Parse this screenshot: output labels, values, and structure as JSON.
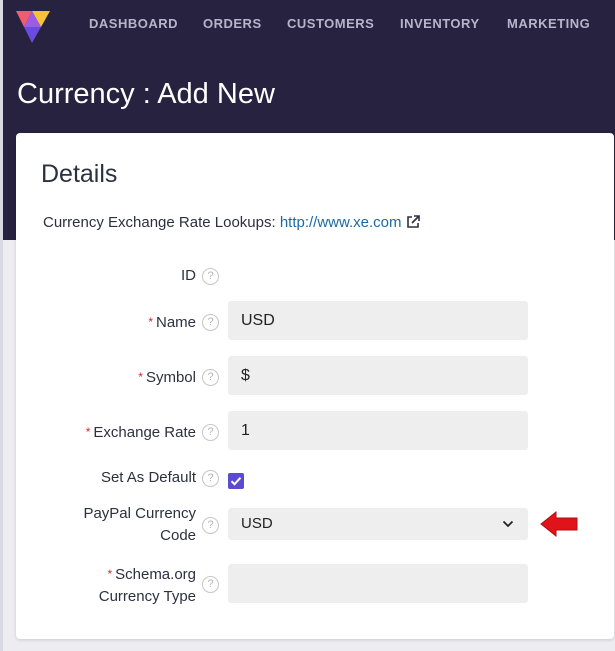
{
  "nav": {
    "items": [
      {
        "label": "DASHBOARD"
      },
      {
        "label": "ORDERS"
      },
      {
        "label": "CUSTOMERS"
      },
      {
        "label": "INVENTORY"
      },
      {
        "label": "MARKETING"
      }
    ]
  },
  "page": {
    "title": "Currency : Add New"
  },
  "details": {
    "title": "Details",
    "lookup_text": "Currency Exchange Rate Lookups:",
    "lookup_link": "http://www.xe.com"
  },
  "form": {
    "id_label": "ID",
    "name_label": "Name",
    "name_value": "USD",
    "symbol_label": "Symbol",
    "symbol_value": "$",
    "rate_label": "Exchange Rate",
    "rate_value": "1",
    "default_label": "Set As Default",
    "default_checked": true,
    "paypal_label_line1": "PayPal Currency",
    "paypal_label_line2": "Code",
    "paypal_value": "USD",
    "schema_label_line1": "Schema.org",
    "schema_label_line2": "Currency Type",
    "schema_value": "",
    "required_mark": "*",
    "help_glyph": "?"
  },
  "colors": {
    "header_bg": "#27223f",
    "accent": "#5a4bd1",
    "link": "#1b6aa5",
    "required": "#d8262c",
    "annotation_arrow": "#e0131a"
  }
}
